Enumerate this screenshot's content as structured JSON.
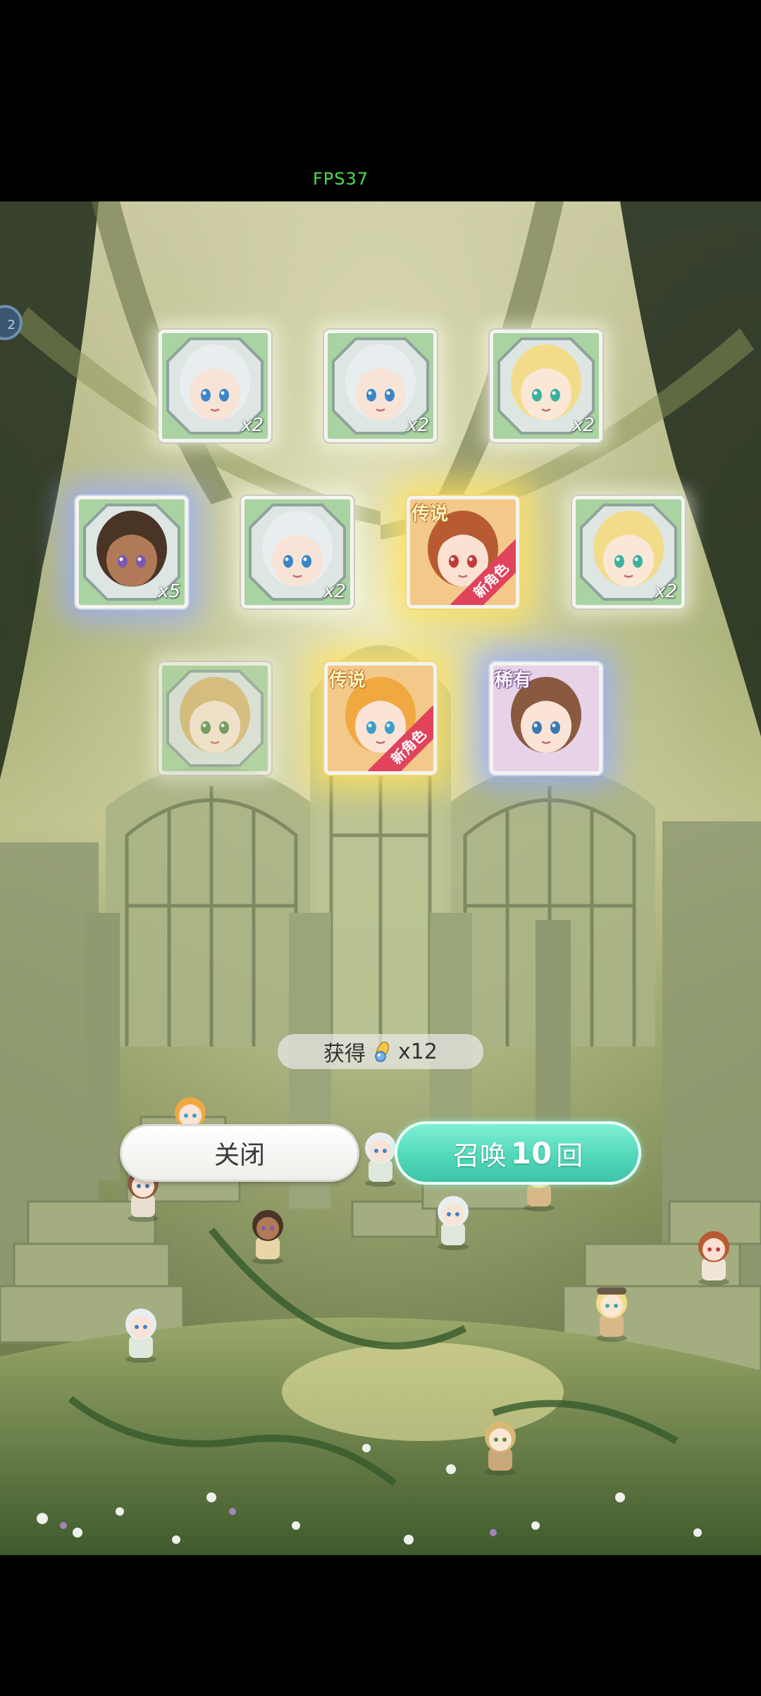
{
  "hud": {
    "fps": "FPS37",
    "side_badge": "2"
  },
  "result_cards": [
    {
      "multiplier": "x2",
      "tag": "",
      "new": "",
      "glow": "white",
      "hair": "#e8eef0",
      "skin": "#f8e4d6",
      "eye": "#3a86c8"
    },
    {
      "multiplier": "x2",
      "tag": "",
      "new": "",
      "glow": "white",
      "hair": "#e8eef0",
      "skin": "#f8e4d6",
      "eye": "#3a86c8"
    },
    {
      "multiplier": "x2",
      "tag": "",
      "new": "",
      "glow": "white",
      "hair": "#f2dc8a",
      "skin": "#fbe7d6",
      "eye": "#3fb0a0"
    },
    {
      "multiplier": "x5",
      "tag": "",
      "new": "",
      "glow": "blue",
      "hair": "#4a3426",
      "skin": "#b07a58",
      "eye": "#7a5ab0"
    },
    {
      "multiplier": "x2",
      "tag": "",
      "new": "",
      "glow": "white",
      "hair": "#e8eef0",
      "skin": "#f8e4d6",
      "eye": "#3a86c8"
    },
    {
      "multiplier": "",
      "tag": "传说",
      "new": "新角色",
      "glow": "gold",
      "hair": "#b85a32",
      "skin": "#fbe1d2",
      "eye": "#c23b3b"
    },
    {
      "multiplier": "x2",
      "tag": "",
      "new": "",
      "glow": "white",
      "hair": "#f2dc8a",
      "skin": "#fbe7d6",
      "eye": "#3fb0a0"
    },
    {
      "multiplier": "",
      "tag": "",
      "new": "",
      "glow": "faded",
      "hair": "#d9b874",
      "skin": "#fbe7d6",
      "eye": "#5b8c4a"
    },
    {
      "multiplier": "",
      "tag": "传说",
      "new": "新角色",
      "glow": "gold",
      "hair": "#f0a840",
      "skin": "#fbe4d6",
      "eye": "#3aa0c8"
    },
    {
      "multiplier": "",
      "tag": "稀有",
      "new": "",
      "glow": "blue",
      "hair": "#8a5a40",
      "skin": "#fbe4d6",
      "eye": "#3a7ab0"
    }
  ],
  "obtain": {
    "label": "获得",
    "item_icon": "crystal-feather-icon",
    "count": "x12"
  },
  "buttons": {
    "close": "关闭",
    "summon_prefix": "召唤",
    "summon_count": "10",
    "summon_suffix": "回"
  },
  "colors": {
    "fps_text": "#46e24a",
    "summon_button": "#4fd6b8",
    "new_ribbon": "#e0435b",
    "legend_tag": "#fff5c0"
  }
}
